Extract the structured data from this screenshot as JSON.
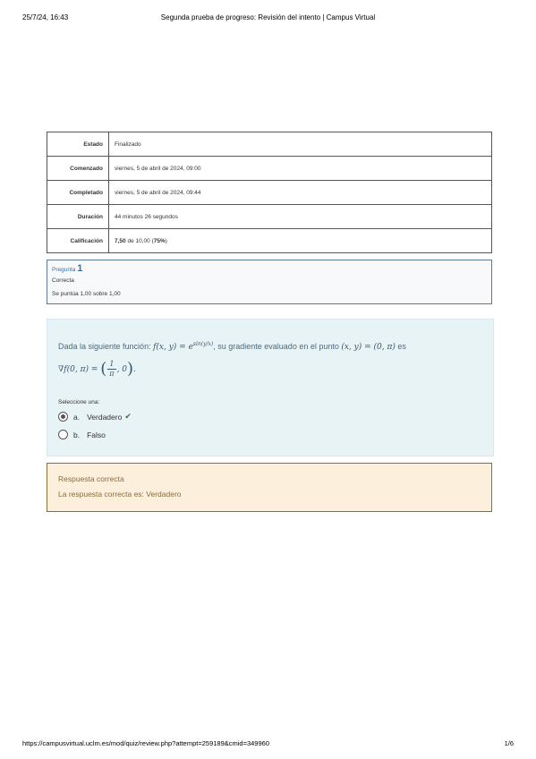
{
  "print_header": {
    "date": "25/7/24, 16:43",
    "title": "Segunda prueba de progreso: Revisión del intento | Campus Virtual"
  },
  "summary": [
    {
      "label": "Estado",
      "value": "Finalizado"
    },
    {
      "label": "Comenzado",
      "value": "viernes, 5 de abril de 2024, 09:00"
    },
    {
      "label": "Completado",
      "value": "viernes, 5 de abril de 2024, 09:44"
    },
    {
      "label": "Duración",
      "value": "44 minutos 26 segundos"
    },
    {
      "label": "Calificación",
      "value_score": "7,50",
      "value_rest": " de 10,00 (",
      "value_percent": "75%",
      "value_end": ")"
    }
  ],
  "question": {
    "label": "Pregunta",
    "number": "1",
    "state": "Correcta",
    "grade": "Se puntúa 1,00 sobre 1,00",
    "text_part1": "Dada la siguiente función: ",
    "text_part2": ", su gradiente evaluado en el punto ",
    "text_part3": " es",
    "prompt": "Seleccione una:",
    "options": [
      {
        "letter": "a.",
        "label": "Verdadero",
        "selected": true,
        "correct": true
      },
      {
        "letter": "b.",
        "label": "Falso",
        "selected": false
      }
    ]
  },
  "feedback": {
    "title": "Respuesta correcta",
    "text": "La respuesta correcta es: Verdadero"
  },
  "print_footer": {
    "url": "https://campusvirtual.uclm.es/mod/quiz/review.php?attempt=259189&cmid=349960",
    "page": "1/6"
  },
  "colors": {
    "formulation_bg": "#e7f3f5",
    "feedback_bg": "#fcefdc",
    "feedback_text": "#8a6d3b",
    "link_blue": "#3a6ea5",
    "correct_green": "#357a32"
  },
  "icons": [
    "check-icon",
    "radio-selected-icon",
    "radio-empty-icon"
  ]
}
